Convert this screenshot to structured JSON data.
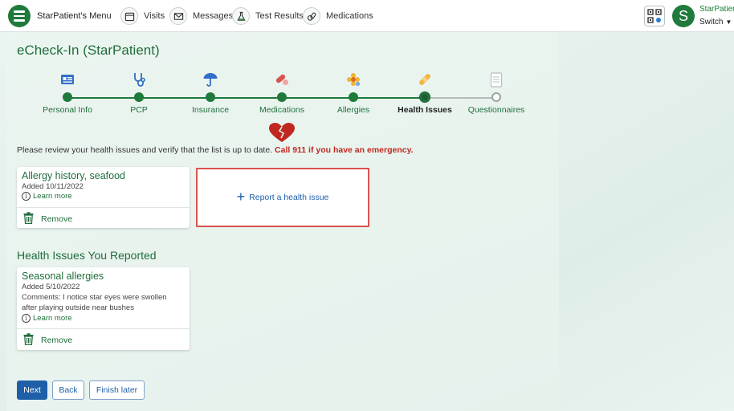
{
  "topbar": {
    "menu_label": "StarPatient's Menu",
    "nav": [
      {
        "label": "Visits",
        "icon": "calendar-icon"
      },
      {
        "label": "Messages",
        "icon": "envelope-icon"
      },
      {
        "label": "Test Results",
        "icon": "flask-icon"
      },
      {
        "label": "Medications",
        "icon": "pills-icon"
      }
    ],
    "qr_icon": "qr-code-icon",
    "avatar_initial": "S",
    "user_name": "StarPatien",
    "switch_label": "Switch"
  },
  "page": {
    "title": "eCheck-In (StarPatient)"
  },
  "stepper": {
    "steps": [
      {
        "label": "Personal Info",
        "icon": "id-card-icon",
        "state": "done"
      },
      {
        "label": "PCP",
        "icon": "stethoscope-icon",
        "state": "done"
      },
      {
        "label": "Insurance",
        "icon": "umbrella-icon",
        "state": "done"
      },
      {
        "label": "Medications",
        "icon": "pill-icon",
        "state": "done"
      },
      {
        "label": "Allergies",
        "icon": "flower-icon",
        "state": "done"
      },
      {
        "label": "Health Issues",
        "icon": "bandage-icon",
        "state": "current"
      },
      {
        "label": "Questionnaires",
        "icon": "clipboard-icon",
        "state": "future"
      }
    ]
  },
  "notice": {
    "text": "Please review your health issues and verify that the list is up to date.",
    "emergency": "Call 911 if you have an emergency."
  },
  "issues": [
    {
      "title": "Allergy history, seafood",
      "added": "Added 10/11/2022",
      "learn_more": "Learn more",
      "remove": "Remove"
    }
  ],
  "report": {
    "label": "Report a health issue"
  },
  "reported": {
    "title": "Health Issues You Reported",
    "items": [
      {
        "title": "Seasonal allergies",
        "added": "Added 5/10/2022",
        "comment_line1": "Comments: I notice star eyes were swollen",
        "comment_line2": "after playing outside near bushes",
        "learn_more": "Learn more",
        "remove": "Remove"
      }
    ]
  },
  "buttons": {
    "next": "Next",
    "back": "Back",
    "finish_later": "Finish later"
  },
  "colors": {
    "brand_green": "#1f7a3c",
    "link_blue": "#1f5fa8",
    "emergency_red": "#c0281f",
    "highlight_red": "#d9534f"
  }
}
